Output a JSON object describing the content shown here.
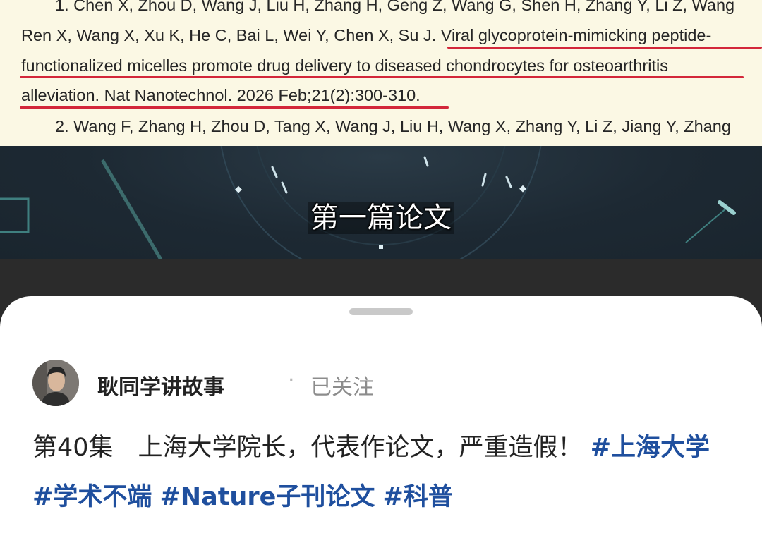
{
  "paper": {
    "line1": "1. Chen X, Zhou D, Wang J, Liu H, Zhang H, Geng Z, Wang G, Shen H, Zhang Y, Li Z, Wang",
    "line2_plain": "Ren X, Wang X, Xu K, He C, Bai L, Wei Y, Chen X, Su J. ",
    "line2_title": "Viral glycoprotein-mimicking peptide-",
    "line3": "functionalized micelles promote drug delivery to diseased chondrocytes for osteoarthritis",
    "line4_highlight": "alleviation. Nat Nanotechnol. 2026 Feb;21(2):300-310",
    "line4_end": ".",
    "line5": "2. Wang F, Zhang H, Zhou D, Tang X, Wang J, Liu H, Wang X, Zhang Y, Li Z, Jiang Y, Zhang"
  },
  "video": {
    "subtitle": "第一篇论文"
  },
  "post": {
    "author_name": "耿同学讲故事",
    "separator": "·",
    "follow_status": "已关注",
    "description": "第40集　上海大学院长，代表作论文，严重造假！",
    "hashtags": [
      "#上海大学",
      "#学术不端",
      "#Nature子刊论文",
      "#科普"
    ]
  },
  "colors": {
    "underline": "#d3273a",
    "hashtag": "#1f4f9e",
    "paper_bg": "#fbf8e4"
  }
}
